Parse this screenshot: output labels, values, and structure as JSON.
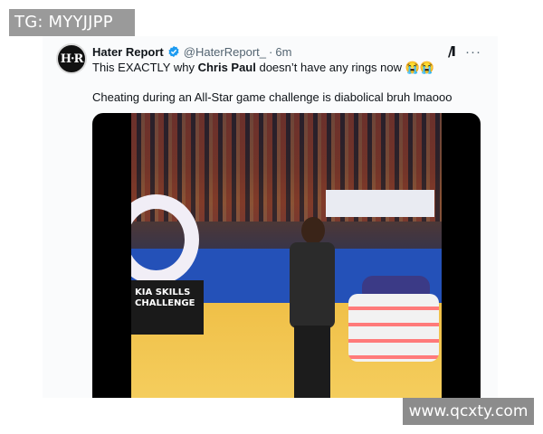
{
  "watermarks": {
    "top_left": "TG: MYYJJPP",
    "bottom_right": "www.qcxty.com"
  },
  "tweet": {
    "avatar_text": "H·R",
    "display_name": "Hater Report",
    "handle": "@HaterReport_",
    "separator": "·",
    "time": "6m",
    "line1": {
      "before": "This EXACTLY why ",
      "bold": "Chris Paul",
      "after": " doesn’t have any rings now 😭😭"
    },
    "line2": "Cheating during an All-Star game challenge is diabolical bruh lmaooo",
    "more_glyph": "···",
    "grok_glyph": "/I"
  },
  "video": {
    "sign_text": "KIA SKILLS CHALLENGE"
  },
  "colors": {
    "verified": "#1d9bf0",
    "text": "#0f1419",
    "muted": "#536471"
  }
}
